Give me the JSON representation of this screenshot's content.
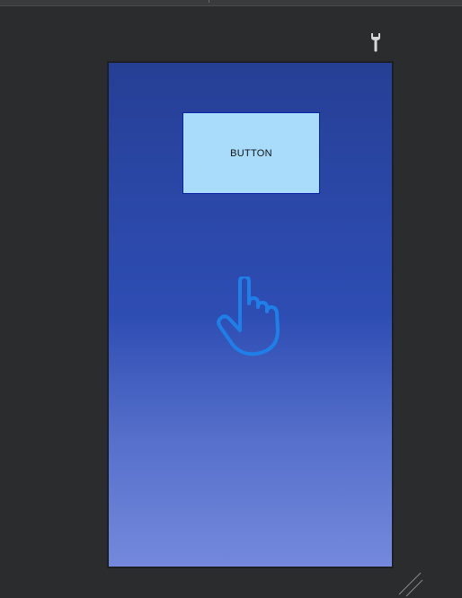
{
  "preview": {
    "button_label": "BUTTON"
  },
  "icons": {
    "settings": "wrench-icon",
    "gesture": "hand-pointer-icon",
    "resize": "resize-handle-icon"
  },
  "colors": {
    "canvas_bg": "#2b2c2d",
    "device_top": "#263f95",
    "device_bottom": "#7489dc",
    "button_bg": "#a9dcfb",
    "button_border": "#0c1fa8",
    "hand_stroke": "#1f7fe8"
  }
}
